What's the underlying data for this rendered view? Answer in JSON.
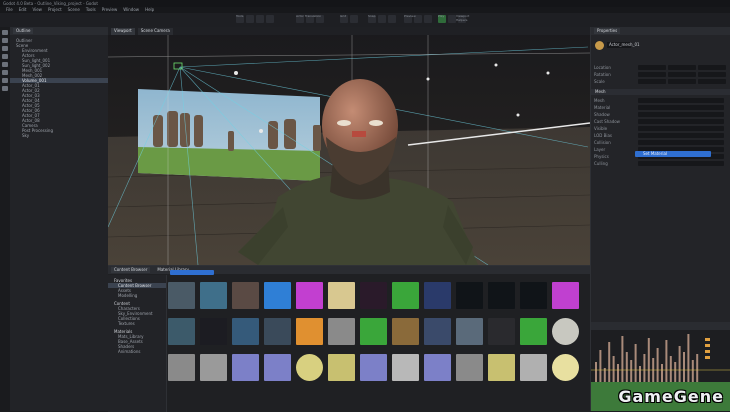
{
  "window": {
    "title": "Godot 4.0 Beta - Outline_Viking_project - Godot"
  },
  "menus": [
    "File",
    "Edit",
    "View",
    "Project",
    "Scene",
    "Tools",
    "Preview",
    "Window",
    "Help"
  ],
  "toolbar": {
    "groups": [
      "Tools",
      "Actor Translation",
      "Grid",
      "Snap",
      "Preview",
      "Play",
      "Viewport Helpers"
    ]
  },
  "outliner": {
    "tab": "Outline",
    "items": [
      "Outliner",
      "Scene",
      "Environment",
      "Actors",
      "Sun_light_001",
      "Sun_light_002",
      "Mesh_001",
      "Mesh_002",
      "Volume_001",
      "Actor_01",
      "Actor_02",
      "Actor_03",
      "Actor_04",
      "Actor_05",
      "Actor_06",
      "Actor_07",
      "Actor_08",
      "Camera",
      "Post Processing",
      "Sky"
    ],
    "selected_index": 8
  },
  "viewport": {
    "tabs": [
      "Viewport",
      "Scene Camera"
    ]
  },
  "properties": {
    "tab": "Properties",
    "object_name": "Actor_mesh_01",
    "rows": [
      "Location",
      "Rotation",
      "Scale"
    ],
    "section": "Mesh",
    "rows2": [
      "Mesh",
      "Material",
      "Shadow",
      "Cast Shadow",
      "Visible",
      "LOD Bias",
      "Collision",
      "Layer",
      "Physics",
      "Culling"
    ],
    "assign_label": "Set Material"
  },
  "browser": {
    "tabs": [
      "Content Browser",
      "Material Library"
    ],
    "tree_sections": [
      "Favorites",
      "Content",
      "Materials"
    ],
    "tree_items": [
      "Content Browser",
      "Assets",
      "Modelling",
      "Characters",
      "Sky_Environment",
      "Collections",
      "Textures",
      "Mats_Library",
      "Base_Assets",
      "Shaders",
      "Animations"
    ]
  },
  "colors": {
    "accent": "#2f6fd1",
    "select": "#3b4350",
    "panel": "#232428"
  },
  "watermark": "GameGene"
}
